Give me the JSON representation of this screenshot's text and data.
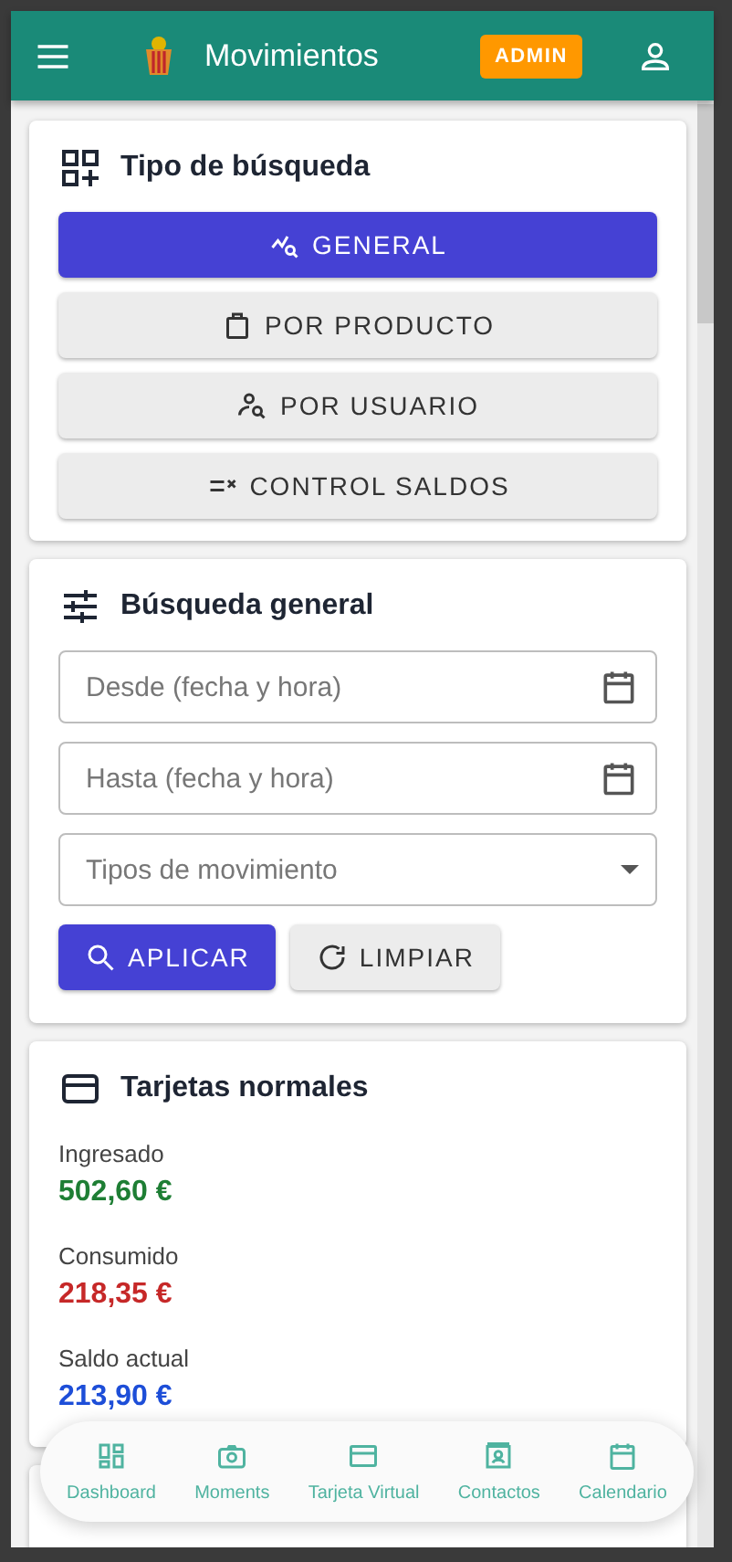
{
  "app_bar": {
    "title": "Movimientos",
    "badge": "ADMIN"
  },
  "search_type": {
    "title": "Tipo de búsqueda",
    "options": [
      {
        "label": "GENERAL",
        "selected": true
      },
      {
        "label": "POR PRODUCTO",
        "selected": false
      },
      {
        "label": "POR USUARIO",
        "selected": false
      },
      {
        "label": "CONTROL SALDOS",
        "selected": false
      }
    ]
  },
  "general_search": {
    "title": "Búsqueda general",
    "fields": [
      {
        "kind": "date",
        "placeholder": "Desde (fecha y hora)"
      },
      {
        "kind": "date",
        "placeholder": "Hasta (fecha y hora)"
      },
      {
        "kind": "select",
        "placeholder": "Tipos de movimiento"
      }
    ],
    "buttons": [
      {
        "label": "APLICAR",
        "kind": "primary"
      },
      {
        "label": "LIMPIAR",
        "kind": "secondary"
      }
    ]
  },
  "normal_cards": {
    "title": "Tarjetas normales",
    "stats": [
      {
        "label": "Ingresado",
        "value": "502,60 €",
        "color": "#1e7e34"
      },
      {
        "label": "Consumido",
        "value": "218,35 €",
        "color": "#c62828"
      },
      {
        "label": "Saldo actual",
        "value": "213,90 €",
        "color": "#1d4ed8"
      }
    ]
  },
  "bottom_nav": [
    {
      "label": "Dashboard"
    },
    {
      "label": "Moments"
    },
    {
      "label": "Tarjeta Virtual"
    },
    {
      "label": "Contactos"
    },
    {
      "label": "Calendario"
    }
  ]
}
